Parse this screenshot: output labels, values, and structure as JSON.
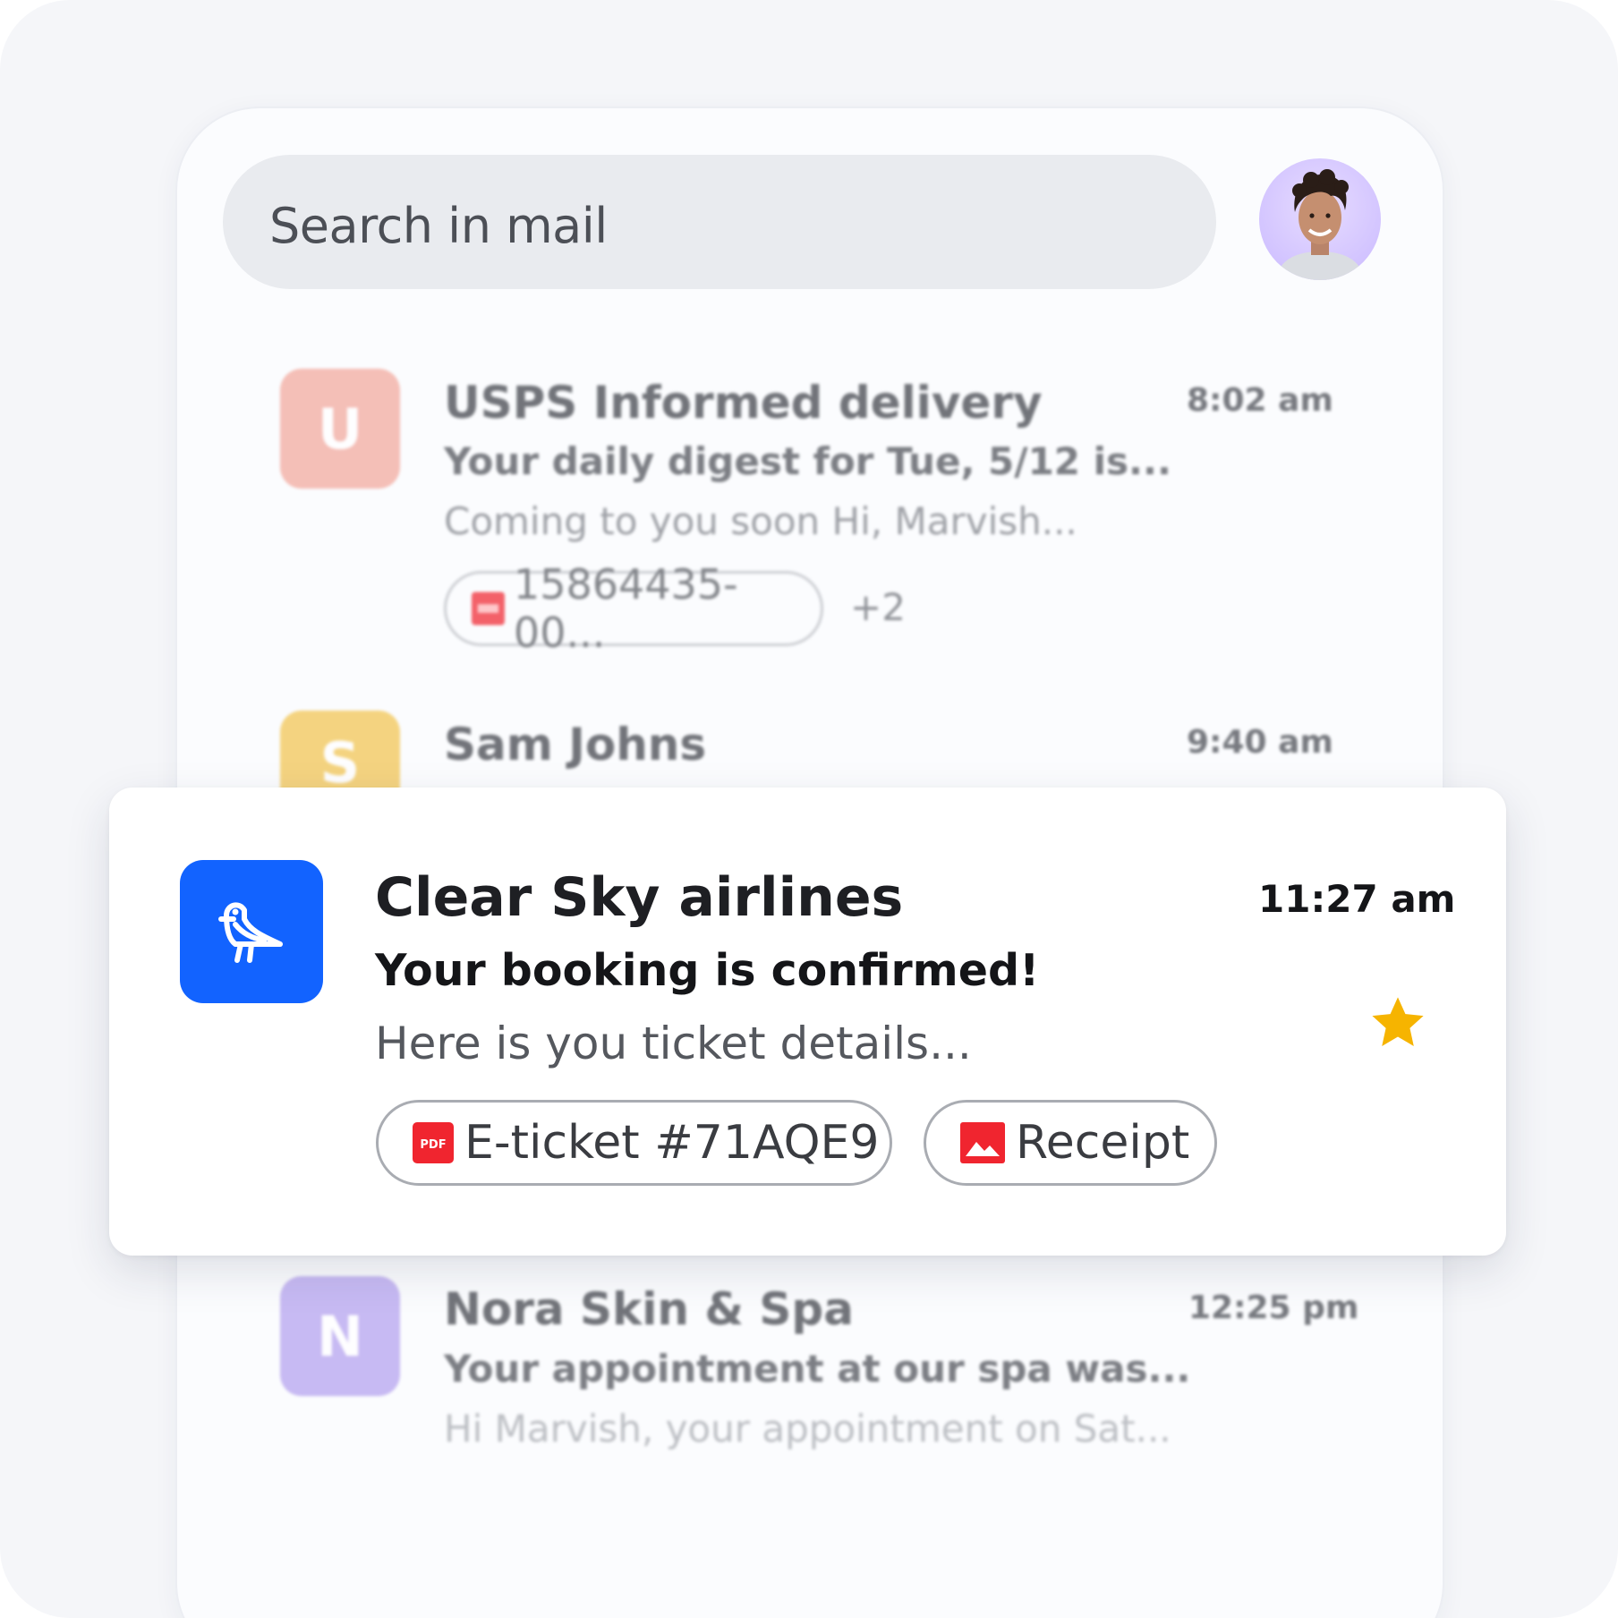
{
  "search": {
    "placeholder": "Search in mail"
  },
  "profile": {
    "avatar_icon": "user-avatar"
  },
  "emails_background": [
    {
      "badge_letter": "U",
      "badge_color": "#f2a79b",
      "sender": "USPS Informed delivery",
      "time": "8:02 am",
      "subject": "Your daily digest for Tue, 5/12 is...",
      "preview": "Coming to you soon Hi, Marvish...",
      "attachment_name": "15864435-00...",
      "attachment_icon": "pdf-icon",
      "extra_attachments": "+2"
    },
    {
      "badge_letter": "S",
      "badge_color": "#f2c44e",
      "sender": "Sam Johns",
      "time": "9:40 am"
    },
    {
      "badge_letter": "N",
      "badge_color": "#b3a0ee",
      "sender": "Nora Skin & Spa",
      "time": "12:25 pm",
      "subject": "Your appointment at our spa was...",
      "preview": "Hi Marvish, your appointment on Sat..."
    }
  ],
  "featured_email": {
    "app_icon": "bird-icon",
    "app_icon_color": "#1263ff",
    "sender": "Clear Sky airlines",
    "time": "11:27 am",
    "subject": "Your booking is confirmed!",
    "preview": "Here is you ticket details...",
    "starred": true,
    "star_color": "#f6b400",
    "attachments": [
      {
        "icon": "pdf-icon",
        "icon_text": "PDF",
        "label": "E-ticket #71AQE9"
      },
      {
        "icon": "image-icon",
        "label": "Receipt"
      }
    ]
  }
}
